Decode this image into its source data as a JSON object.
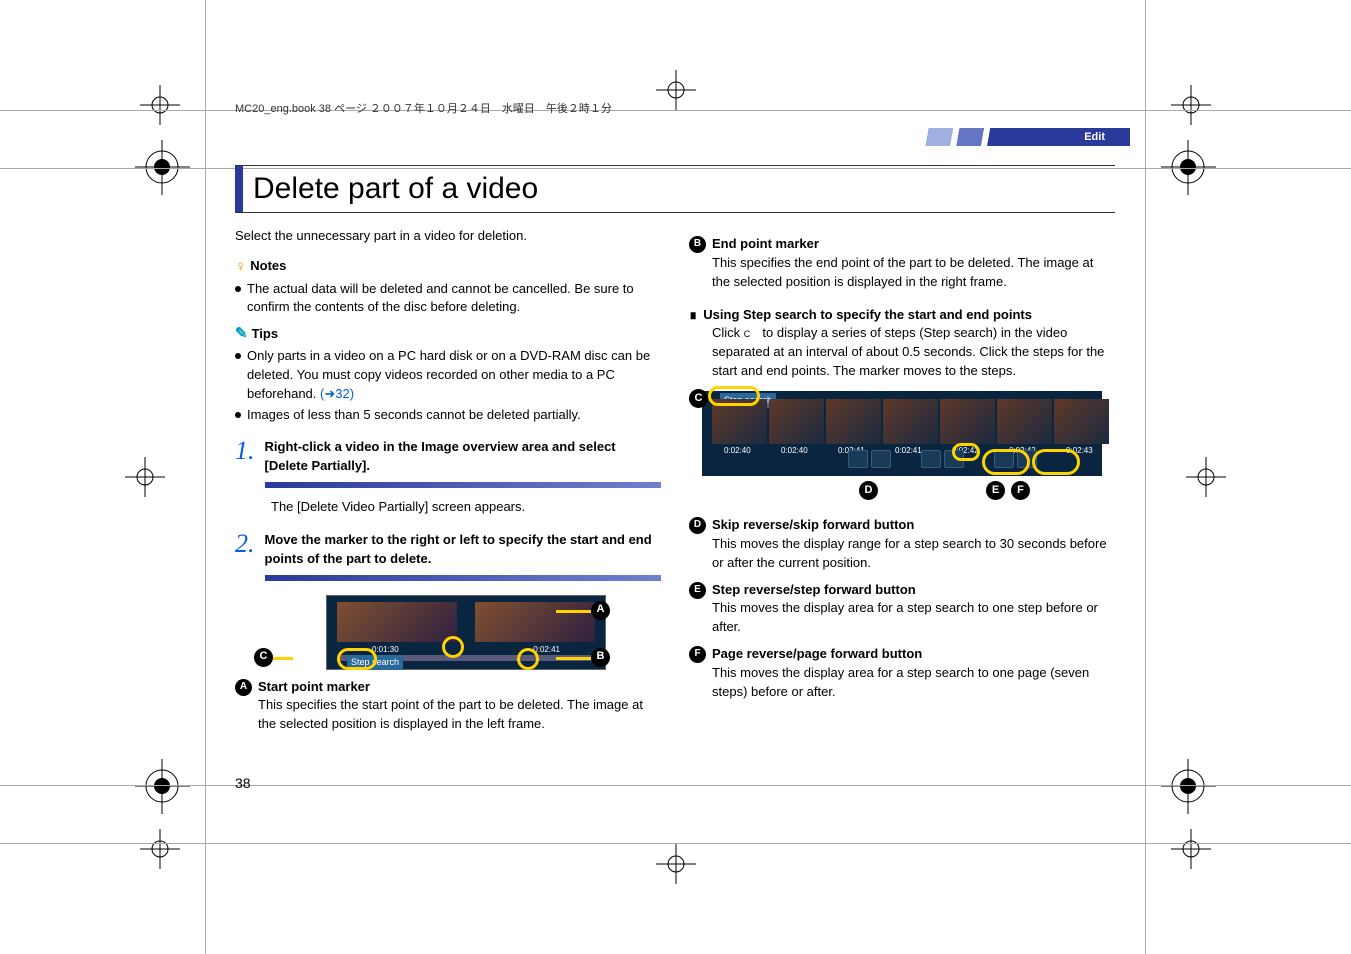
{
  "header_line": "MC20_eng.book  38 ページ  ２００７年１０月２４日　水曜日　午後２時１分",
  "section_tab": "Edit",
  "title": "Delete part of a video",
  "col_left": {
    "intro": "Select the unnecessary part in a video for deletion.",
    "notes_hd": "Notes",
    "note1": "The actual data will be deleted and cannot be cancelled. Be sure to confirm the contents of the disc before deleting.",
    "tips_hd": "Tips",
    "tip1_a": "Only parts in a video on a PC hard disk or on a DVD-RAM disc can be deleted. You must copy videos recorded on other media to a PC beforehand. ",
    "tip1_link": "(➜32)",
    "tip2": "Images of less than 5 seconds cannot be deleted partially.",
    "step1": {
      "num": "1.",
      "text": "Right-click a video in the Image overview area and select [Delete Partially]."
    },
    "caption1": "The [Delete Video Partially] screen appears.",
    "step2": {
      "num": "2.",
      "text": "Move the marker to the right or left to specify the start and end points of the part to delete."
    },
    "img1": {
      "step_search_btn": "Step search",
      "ts_left": "0:01:30",
      "ts_right": "0:02:41",
      "callout_A": "A",
      "callout_B": "B",
      "callout_C": "C"
    },
    "subA_hd": "Start point marker",
    "subA_body": "This specifies the start point of the part to be deleted. The image at the selected position is displayed in the left frame."
  },
  "col_right": {
    "subB_hd": "End point marker",
    "subB_body": "This specifies the end point of the part to be deleted. The image at the selected position is displayed in the right frame.",
    "block_hd": "Using Step search to specify the start and end points",
    "block_p1a": "Click ",
    "block_p1b": " to display a series of steps (Step search) in the video separated at an interval of about 0.5 seconds. Click the steps for the start and end points. The marker moves to the steps.",
    "img2": {
      "step_search": "Step search",
      "ts": [
        "0:02:40",
        "0:02:40",
        "0:02:41",
        "0:02:41",
        "0:02:42",
        "0:02:42",
        "0:02:43"
      ],
      "callout_C": "C",
      "callout_D": "D",
      "callout_E": "E",
      "callout_F": "F"
    },
    "subD_hd": "Skip reverse/skip forward button",
    "subD_body": "This moves the display range for a step search to 30 seconds before or after the current position.",
    "subE_hd": "Step reverse/step forward button",
    "subE_body": "This moves the display area for a step search to one step before or after.",
    "subF_hd": "Page reverse/page forward button",
    "subF_body": "This moves the display area for a step search to one page (seven steps) before or after."
  },
  "page_num": "38",
  "labels": {
    "A": "A",
    "B": "B",
    "C": "C",
    "D": "D",
    "E": "E",
    "F": "F"
  }
}
